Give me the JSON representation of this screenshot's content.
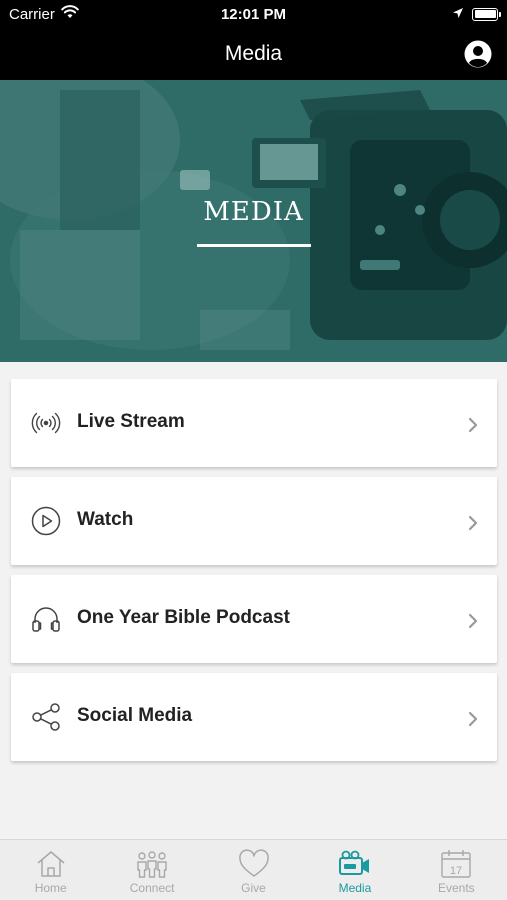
{
  "status_bar": {
    "carrier": "Carrier",
    "time": "12:01 PM"
  },
  "nav": {
    "title": "Media"
  },
  "hero": {
    "title": "MEDIA"
  },
  "menu": [
    {
      "label": "Live Stream",
      "icon": "live-stream-icon"
    },
    {
      "label": "Watch",
      "icon": "play-circle-icon"
    },
    {
      "label": "One Year Bible Podcast",
      "icon": "headphones-icon"
    },
    {
      "label": "Social Media",
      "icon": "share-icon"
    }
  ],
  "tabs": [
    {
      "label": "Home",
      "icon": "home-icon",
      "active": false
    },
    {
      "label": "Connect",
      "icon": "people-icon",
      "active": false
    },
    {
      "label": "Give",
      "icon": "heart-icon",
      "active": false
    },
    {
      "label": "Media",
      "icon": "video-camera-icon",
      "active": true
    },
    {
      "label": "Events",
      "icon": "calendar-icon",
      "active": false,
      "calendar_day": "17"
    }
  ],
  "colors": {
    "accent": "#1b9aa0",
    "hero_tint": "#2d6a66",
    "tab_inactive": "#a8a8a8"
  }
}
